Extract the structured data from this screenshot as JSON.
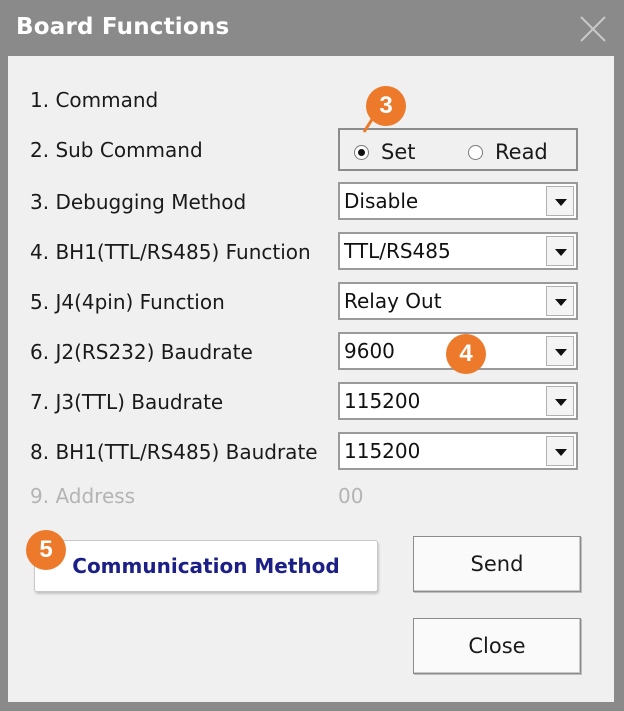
{
  "window": {
    "title": "Board Functions"
  },
  "form": {
    "rows": [
      {
        "label": "1. Command"
      },
      {
        "label": "2. Sub Command"
      },
      {
        "label": "3. Debugging Method",
        "value": "Disable"
      },
      {
        "label": "4. BH1(TTL/RS485) Function",
        "value": "TTL/RS485"
      },
      {
        "label": "5. J4(4pin) Function",
        "value": "Relay Out"
      },
      {
        "label": "6. J2(RS232) Baudrate",
        "value": "9600"
      },
      {
        "label": "7. J3(TTL) Baudrate",
        "value": "115200"
      },
      {
        "label": "8. BH1(TTL/RS485) Baudrate",
        "value": "115200"
      },
      {
        "label": "9. Address",
        "value": "00"
      }
    ],
    "sub_command": {
      "options": [
        "Set",
        "Read"
      ],
      "selected": "Set"
    }
  },
  "buttons": {
    "communication_method": "Communication Method",
    "send": "Send",
    "close": "Close"
  },
  "annotations": [
    {
      "number": "3"
    },
    {
      "number": "4"
    },
    {
      "number": "5"
    }
  ],
  "colors": {
    "title_text": "#ffffff",
    "frame": "#8a8a8a",
    "client_bg": "#f0f0f0",
    "badge": "#ec7a2a",
    "comm_button_text": "#1c1f86",
    "disabled_text": "#b4b4b4"
  },
  "icons": {
    "close": "close-x-icon",
    "dropdown": "chevron-down-icon",
    "radio": "radio-icon"
  }
}
